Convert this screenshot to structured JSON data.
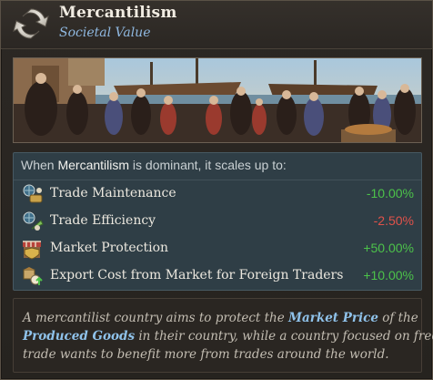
{
  "header": {
    "title": "Mercantilism",
    "subtitle": "Societal Value",
    "icon": "circular-arrows-icon"
  },
  "illustration": {
    "icon": "market-scene-illustration"
  },
  "effects": {
    "intro_prefix": "When ",
    "intro_subject": "Mercantilism",
    "intro_suffix": " is dominant, it scales up to:",
    "rows": [
      {
        "label": "Trade Maintenance",
        "value": "-10.00%",
        "icon": "trade-maintenance-icon",
        "color": "#4cc24a"
      },
      {
        "label": "Trade Efficiency",
        "value": "-2.50%",
        "icon": "trade-efficiency-icon",
        "color": "#e0524a"
      },
      {
        "label": "Market Protection",
        "value": "+50.00%",
        "icon": "market-protection-icon",
        "color": "#4cc24a"
      },
      {
        "label": "Export Cost from Market for Foreign Traders",
        "value": "+10.00%",
        "icon": "export-cost-icon",
        "color": "#4cc24a"
      }
    ]
  },
  "description": {
    "line1_a": "A mercantilist country aims to protect the ",
    "line1_link": "Market Price",
    "line1_b": " of the",
    "line2_link": "Produced Goods",
    "line2_b": " in their country, while a country focused on free",
    "line3": "trade wants to benefit more from trades around the world."
  }
}
